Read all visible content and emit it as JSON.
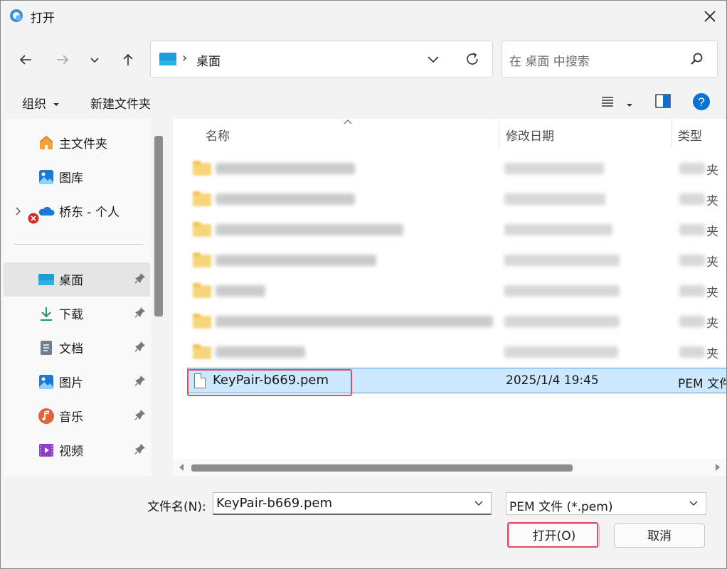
{
  "window": {
    "title": "打开"
  },
  "address": {
    "location": "桌面",
    "separator": "›"
  },
  "search": {
    "placeholder": "在 桌面 中搜索"
  },
  "toolbar": {
    "organize": "组织",
    "new_folder": "新建文件夹"
  },
  "sidebar": {
    "items": [
      {
        "label": "主文件夹",
        "icon": "home-icon"
      },
      {
        "label": "图库",
        "icon": "gallery-icon"
      },
      {
        "label": "桥东 - 个人",
        "icon": "onedrive-icon"
      },
      {
        "label": "桌面",
        "icon": "desktop-icon",
        "selected": true
      },
      {
        "label": "下载",
        "icon": "download-icon"
      },
      {
        "label": "文档",
        "icon": "document-icon"
      },
      {
        "label": "图片",
        "icon": "pictures-icon"
      },
      {
        "label": "音乐",
        "icon": "music-icon"
      },
      {
        "label": "视频",
        "icon": "video-icon"
      }
    ]
  },
  "columns": {
    "name": "名称",
    "date": "修改日期",
    "type": "类型"
  },
  "folder_type_tail": "夹",
  "selected_file": {
    "name": "KeyPair-b669.pem",
    "date": "2025/1/4 19:45",
    "type": "PEM 文件"
  },
  "footer": {
    "filename_label": "文件名(N):",
    "filename_value": "KeyPair-b669.pem",
    "filetype_value": "PEM 文件 (*.pem)",
    "open_label": "打开(O)",
    "cancel_label": "取消"
  },
  "colors": {
    "accent": "#0067c0",
    "selection": "#cce8ff",
    "highlight_box": "#e04d5f"
  }
}
